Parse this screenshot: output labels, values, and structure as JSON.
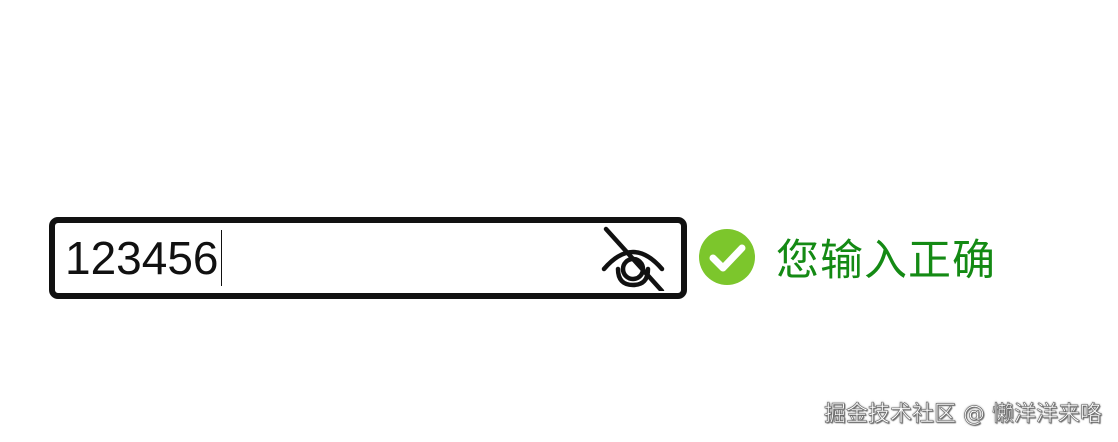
{
  "password_input": {
    "value": "123456",
    "visibility_toggle_icon": "eye-slash-icon"
  },
  "validation": {
    "status_icon": "check-circle-icon",
    "message": "您输入正确",
    "message_color": "#148a14",
    "icon_color": "#7cc62c"
  },
  "watermark": {
    "text": "掘金技术社区 @ 懒洋洋来咯"
  }
}
